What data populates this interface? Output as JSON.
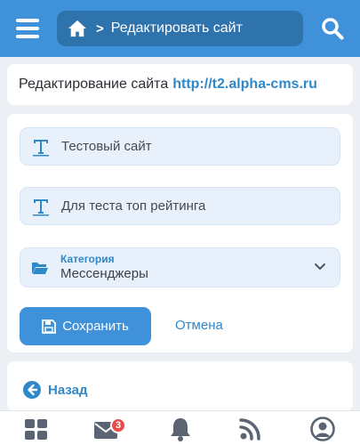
{
  "header": {
    "breadcrumb_label": "Редактировать сайт",
    "color": "#3f91d9",
    "pill_color": "#2f73ad",
    "icons": [
      "menu-icon",
      "home-icon",
      "chevron-right-icon",
      "search-icon"
    ]
  },
  "title_card": {
    "prefix": "Редактирование сайта",
    "host": "http://t2.alpha-cms.ru"
  },
  "form": {
    "name_value": "Тестовый сайт",
    "description_value": "Для теста топ рейтинга",
    "category_label": "Категория",
    "category_value": "Мессенджеры",
    "save_label": "Сохранить",
    "cancel_label": "Отмена"
  },
  "back": {
    "label": "Назад"
  },
  "bottom_nav": {
    "items": [
      "grid-icon",
      "mail-icon",
      "bell-icon",
      "rss-icon",
      "user-icon"
    ],
    "mail_badge": "3",
    "icon_color": "#5a6472"
  }
}
